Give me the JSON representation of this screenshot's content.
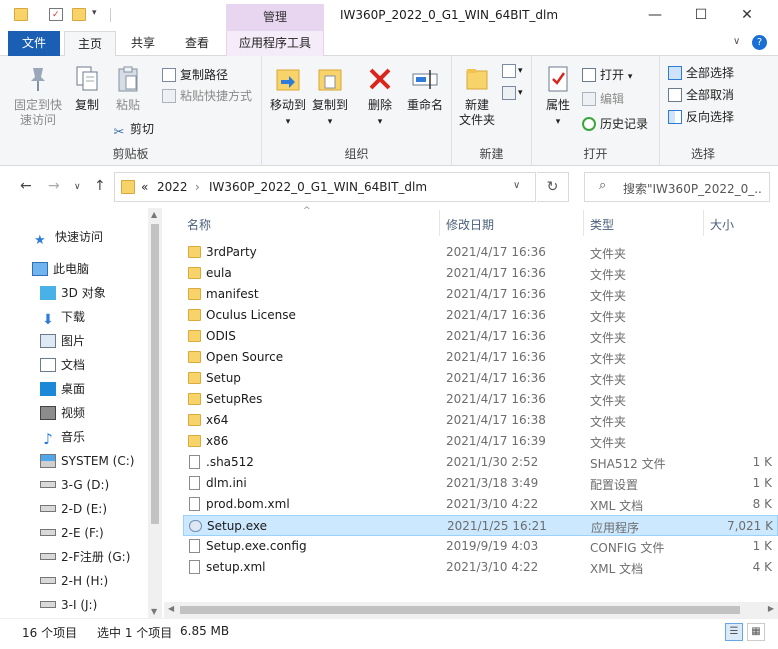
{
  "titlebar": {
    "title": "IW360P_2022_0_G1_WIN_64BIT_dlm",
    "manage_tab": "管理",
    "minimize": "—",
    "maximize": "☐",
    "close": "✕"
  },
  "tabs": {
    "file": "文件",
    "home": "主页",
    "share": "共享",
    "view": "查看",
    "app_tools": "应用程序工具"
  },
  "ribbon": {
    "clipboard": {
      "label": "剪贴板",
      "pin": "固定到快\n速访问",
      "copy": "复制",
      "paste": "粘贴",
      "copy_path": "复制路径",
      "paste_shortcut": "粘贴快捷方式",
      "cut": "剪切"
    },
    "organize": {
      "label": "组织",
      "move_to": "移动到",
      "copy_to": "复制到",
      "delete": "删除",
      "rename": "重命名"
    },
    "new": {
      "label": "新建",
      "new_folder": "新建\n文件夹"
    },
    "open": {
      "label": "打开",
      "properties": "属性",
      "open": "打开",
      "edit": "编辑",
      "history": "历史记录"
    },
    "select": {
      "label": "选择",
      "select_all": "全部选择",
      "select_none": "全部取消",
      "invert": "反向选择"
    }
  },
  "address": {
    "breadcrumb_prefix": "«",
    "crumb1": "2022",
    "crumb2": "IW360P_2022_0_G1_WIN_64BIT_dlm",
    "search_placeholder": "搜索\"IW360P_2022_0_..."
  },
  "navpane": {
    "quick_access": "快速访问",
    "this_pc": "此电脑",
    "items": [
      {
        "label": "3D 对象"
      },
      {
        "label": "下载"
      },
      {
        "label": "图片"
      },
      {
        "label": "文档"
      },
      {
        "label": "桌面"
      },
      {
        "label": "视频"
      },
      {
        "label": "音乐"
      },
      {
        "label": "SYSTEM (C:)"
      },
      {
        "label": "3-G (D:)"
      },
      {
        "label": "2-D (E:)"
      },
      {
        "label": "2-E (F:)"
      },
      {
        "label": "2-F注册 (G:)"
      },
      {
        "label": "2-H (H:)"
      },
      {
        "label": "3-I (J:)"
      }
    ]
  },
  "columns": {
    "name": "名称",
    "date": "修改日期",
    "type": "类型",
    "size": "大小"
  },
  "files": [
    {
      "name": "3rdParty",
      "date": "2021/4/17 16:36",
      "type": "文件夹",
      "size": "",
      "kind": "folder"
    },
    {
      "name": "eula",
      "date": "2021/4/17 16:36",
      "type": "文件夹",
      "size": "",
      "kind": "folder"
    },
    {
      "name": "manifest",
      "date": "2021/4/17 16:36",
      "type": "文件夹",
      "size": "",
      "kind": "folder"
    },
    {
      "name": "Oculus License",
      "date": "2021/4/17 16:36",
      "type": "文件夹",
      "size": "",
      "kind": "folder"
    },
    {
      "name": "ODIS",
      "date": "2021/4/17 16:36",
      "type": "文件夹",
      "size": "",
      "kind": "folder"
    },
    {
      "name": "Open Source",
      "date": "2021/4/17 16:36",
      "type": "文件夹",
      "size": "",
      "kind": "folder"
    },
    {
      "name": "Setup",
      "date": "2021/4/17 16:36",
      "type": "文件夹",
      "size": "",
      "kind": "folder"
    },
    {
      "name": "SetupRes",
      "date": "2021/4/17 16:36",
      "type": "文件夹",
      "size": "",
      "kind": "folder"
    },
    {
      "name": "x64",
      "date": "2021/4/17 16:38",
      "type": "文件夹",
      "size": "",
      "kind": "folder"
    },
    {
      "name": "x86",
      "date": "2021/4/17 16:39",
      "type": "文件夹",
      "size": "",
      "kind": "folder"
    },
    {
      "name": ".sha512",
      "date": "2021/1/30 2:52",
      "type": "SHA512 文件",
      "size": "1 K",
      "kind": "file"
    },
    {
      "name": "dlm.ini",
      "date": "2021/3/18 3:49",
      "type": "配置设置",
      "size": "1 K",
      "kind": "file"
    },
    {
      "name": "prod.bom.xml",
      "date": "2021/3/10 4:22",
      "type": "XML 文档",
      "size": "8 K",
      "kind": "file"
    },
    {
      "name": "Setup.exe",
      "date": "2021/1/25 16:21",
      "type": "应用程序",
      "size": "7,021 K",
      "kind": "exe",
      "selected": true
    },
    {
      "name": "Setup.exe.config",
      "date": "2019/9/19 4:03",
      "type": "CONFIG 文件",
      "size": "1 K",
      "kind": "file"
    },
    {
      "name": "setup.xml",
      "date": "2021/3/10 4:22",
      "type": "XML 文档",
      "size": "4 K",
      "kind": "file"
    }
  ],
  "status": {
    "count": "16 个项目",
    "selected": "选中 1 个项目",
    "size": "6.85 MB"
  },
  "colors": {
    "file_tab": "#1a5fb4",
    "manage_tab": "#e8d5f0",
    "selected_row": "#cce8ff",
    "folder": "#f7d36a"
  }
}
